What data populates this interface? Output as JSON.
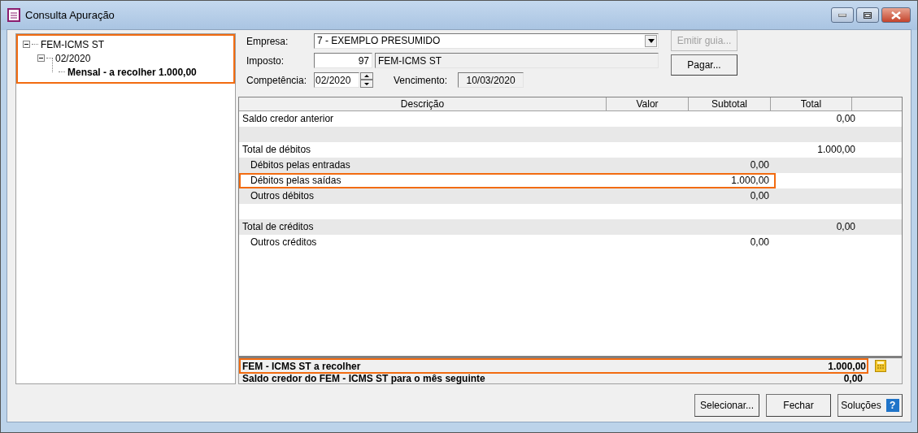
{
  "window": {
    "title": "Consulta Apuração"
  },
  "tree": {
    "highlighted": true,
    "items": [
      {
        "label": "FEM-ICMS ST",
        "expanded": true,
        "selected": false,
        "children": [
          {
            "label": "02/2020",
            "expanded": true,
            "selected": false,
            "children": [
              {
                "label": "Mensal - a recolher 1.000,00",
                "selected": true
              }
            ]
          }
        ]
      }
    ]
  },
  "form": {
    "empresa": {
      "label": "Empresa:",
      "value": "7 - EXEMPLO PRESUMIDO"
    },
    "imposto": {
      "label": "Imposto:",
      "code": "97",
      "name": "FEM-ICMS ST"
    },
    "competencia": {
      "label": "Competência:",
      "value": "02/2020"
    },
    "vencimento": {
      "label": "Vencimento:",
      "value": "10/03/2020"
    }
  },
  "side_buttons": [
    {
      "label": "Emitir guia...",
      "disabled": true
    },
    {
      "label": "Pagar...",
      "disabled": false
    }
  ],
  "table": {
    "columns": [
      "Descrição",
      "Valor",
      "Subtotal",
      "Total"
    ],
    "rows": [
      {
        "kind": "line",
        "description": "Saldo credor anterior",
        "total": "0,00",
        "highlighted": false
      },
      {
        "kind": "spacer"
      },
      {
        "kind": "line",
        "description": "Total de débitos",
        "total": "1.000,00",
        "highlighted": false,
        "children": [
          {
            "description": "Débitos pelas entradas",
            "subtotal": "0,00",
            "highlighted": false
          },
          {
            "description": "Débitos pelas saídas",
            "subtotal": "1.000,00",
            "highlighted": true
          },
          {
            "description": "Outros débitos",
            "subtotal": "0,00",
            "highlighted": false
          }
        ]
      },
      {
        "kind": "spacer"
      },
      {
        "kind": "line",
        "description": "Total de créditos",
        "total": "0,00",
        "highlighted": false,
        "children": [
          {
            "description": "Outros créditos",
            "subtotal": "0,00",
            "highlighted": false
          }
        ]
      }
    ]
  },
  "summary": [
    {
      "label": "FEM - ICMS ST a recolher",
      "value": "1.000,00",
      "highlighted": true,
      "calculator": true
    },
    {
      "label": "Saldo credor do FEM - ICMS ST para o mês seguinte",
      "value": "0,00",
      "highlighted": false,
      "calculator": false
    }
  ],
  "footer_buttons": [
    {
      "label": "Selecionar..."
    },
    {
      "label": "Fechar"
    },
    {
      "label": "Soluções",
      "icon_text": "?"
    }
  ]
}
